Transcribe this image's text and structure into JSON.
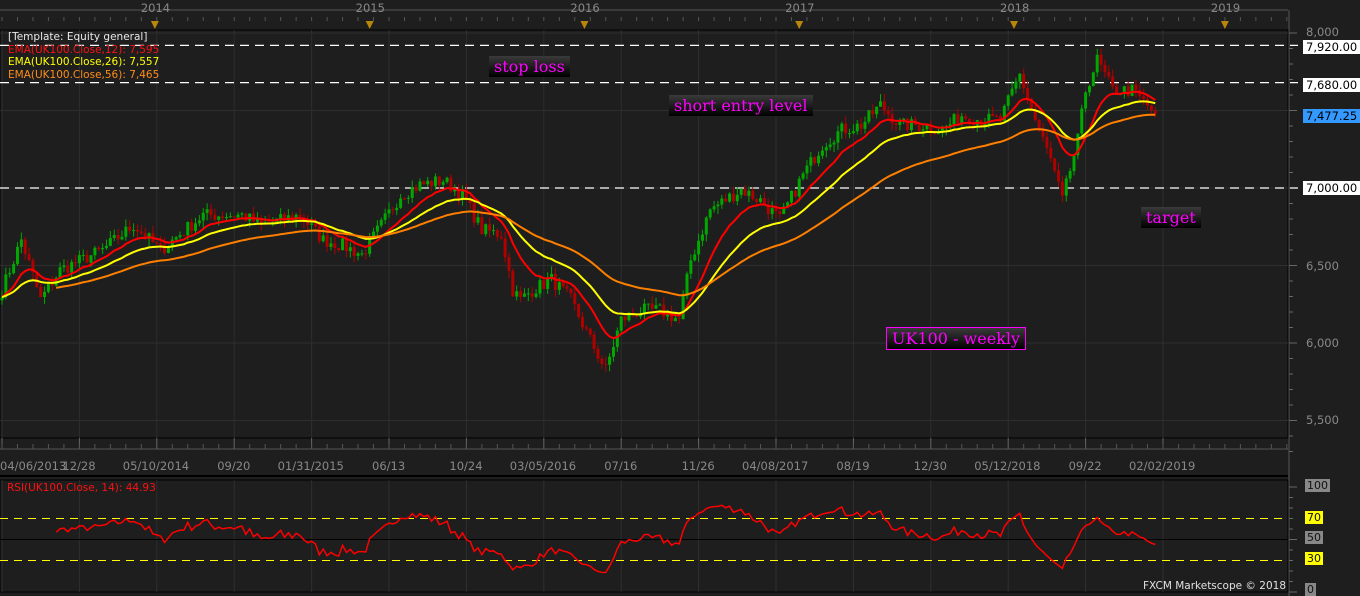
{
  "legend": {
    "template": "[Template: Equity general]",
    "ema12": "EMA(UK100.Close,12): 7,595",
    "ema26": "EMA(UK100.Close,26): 7,557",
    "ema56": "EMA(UK100.Close,56): 7,465"
  },
  "annotations": {
    "stop_loss": "stop loss",
    "short_entry": "short entry level",
    "target": "target",
    "title_box": "UK100 - weekly"
  },
  "price_labels": {
    "stop": "7,920.00",
    "entry": "7,680.00",
    "current": "7,477.25",
    "target": "7,000.00"
  },
  "rsi": {
    "title": "RSI(UK100.Close, 14): 44.93",
    "levels": [
      "100",
      "70",
      "50",
      "30",
      "0"
    ]
  },
  "credit": "FXCM Marketscope © 2018",
  "colors": {
    "bull": "#00a800",
    "bear": "#b00000",
    "ema12": "#ff0000",
    "ema26": "#ffff00",
    "ema56": "#ff7f00",
    "rsi": "#ff0000",
    "current": "#3399ff"
  },
  "chart_data": {
    "type": "candlestick",
    "symbol": "UK100",
    "interval": "weekly",
    "ylim": [
      5300,
      8000
    ],
    "yticks": [
      "8,000",
      "6,500",
      "6,000",
      "5,500"
    ],
    "ytick_values": [
      8000,
      6500,
      6000,
      5500
    ],
    "hlines": [
      7920,
      7680,
      7000
    ],
    "current_price": 7477.25,
    "date_labels": [
      "04/06/2013",
      "12/28",
      "05/10/2014",
      "09/20",
      "01/31/2015",
      "06/13",
      "10/24",
      "03/05/2016",
      "07/16",
      "11/26",
      "04/08/2017",
      "08/19",
      "12/30",
      "05/12/2018",
      "09/22",
      "02/02/2019"
    ],
    "date_label_step_weeks": 20,
    "years": [
      {
        "label": "2014",
        "week": 39.5
      },
      {
        "label": "2015",
        "week": 95
      },
      {
        "label": "2016",
        "week": 150.5
      },
      {
        "label": "2017",
        "week": 206
      },
      {
        "label": "2018",
        "week": 261.5
      },
      {
        "label": "2019",
        "week": 316
      }
    ],
    "close_anchors": [
      [
        0,
        6340
      ],
      [
        5,
        6665
      ],
      [
        10,
        6280
      ],
      [
        15,
        6470
      ],
      [
        26,
        6600
      ],
      [
        34,
        6760
      ],
      [
        41,
        6600
      ],
      [
        52,
        6825
      ],
      [
        62,
        6825
      ],
      [
        67,
        6760
      ],
      [
        77,
        6825
      ],
      [
        83,
        6665
      ],
      [
        88,
        6630
      ],
      [
        93,
        6570
      ],
      [
        98,
        6760
      ],
      [
        103,
        6955
      ],
      [
        108,
        7020
      ],
      [
        114,
        7050
      ],
      [
        119,
        6955
      ],
      [
        124,
        6730
      ],
      [
        129,
        6700
      ],
      [
        132,
        6340
      ],
      [
        134,
        6280
      ],
      [
        137,
        6340
      ],
      [
        142,
        6410
      ],
      [
        147,
        6280
      ],
      [
        152,
        6020
      ],
      [
        156,
        5825
      ],
      [
        160,
        6150
      ],
      [
        165,
        6210
      ],
      [
        170,
        6210
      ],
      [
        175,
        6150
      ],
      [
        178,
        6535
      ],
      [
        183,
        6860
      ],
      [
        191,
        6990
      ],
      [
        196,
        6920
      ],
      [
        201,
        6795
      ],
      [
        207,
        7085
      ],
      [
        212,
        7280
      ],
      [
        217,
        7375
      ],
      [
        222,
        7405
      ],
      [
        227,
        7535
      ],
      [
        232,
        7405
      ],
      [
        238,
        7405
      ],
      [
        243,
        7375
      ],
      [
        248,
        7470
      ],
      [
        253,
        7440
      ],
      [
        258,
        7440
      ],
      [
        263,
        7730
      ],
      [
        267,
        7440
      ],
      [
        271,
        7180
      ],
      [
        274,
        6920
      ],
      [
        278,
        7310
      ],
      [
        280,
        7630
      ],
      [
        283,
        7825
      ],
      [
        287,
        7630
      ],
      [
        292,
        7630
      ],
      [
        298,
        7480
      ]
    ],
    "ema_periods": [
      12,
      26,
      56
    ],
    "rsi_period": 14,
    "rsi_levels": [
      70,
      50,
      30
    ]
  }
}
